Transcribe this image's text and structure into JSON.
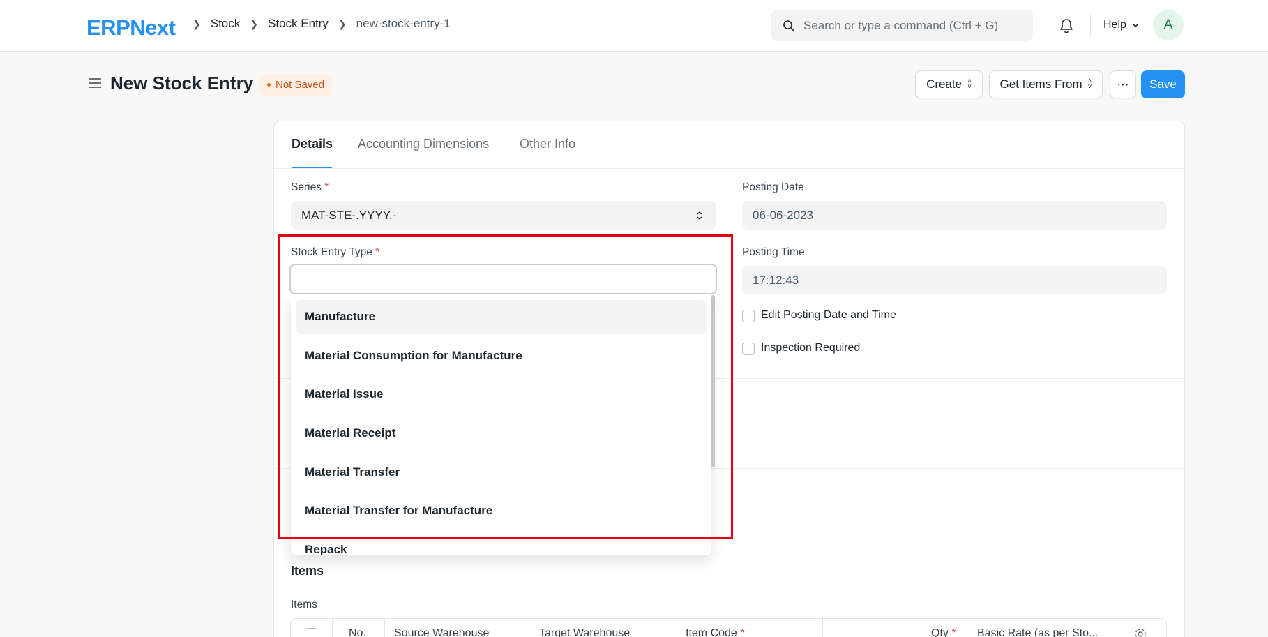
{
  "app": {
    "logo_text": "ERPNext",
    "brand_color": "#2490ef"
  },
  "breadcrumbs": [
    "Stock",
    "Stock Entry",
    "new-stock-entry-1"
  ],
  "search": {
    "placeholder": "Search or type a command (Ctrl + G)"
  },
  "nav": {
    "help_label": "Help",
    "avatar_letter": "A"
  },
  "page": {
    "title": "New Stock Entry",
    "status": "Not Saved"
  },
  "actions": {
    "create": "Create",
    "get_items_from": "Get Items From",
    "more": "···",
    "save": "Save"
  },
  "tabs": [
    "Details",
    "Accounting Dimensions",
    "Other Info"
  ],
  "form": {
    "series_label": "Series",
    "series_value": "MAT-STE-.YYYY.-",
    "stock_entry_type_label": "Stock Entry Type",
    "stock_entry_type_value": "",
    "posting_date_label": "Posting Date",
    "posting_date_value": "06-06-2023",
    "posting_time_label": "Posting Time",
    "posting_time_value": "17:12:43",
    "edit_posting_label": "Edit Posting Date and Time",
    "inspection_label": "Inspection Required"
  },
  "dropdown_options": [
    "Manufacture",
    "Material Consumption for Manufacture",
    "Material Issue",
    "Material Receipt",
    "Material Transfer",
    "Material Transfer for Manufacture",
    "Repack"
  ],
  "items": {
    "section_title": "Items",
    "table_label": "Items",
    "columns": [
      "No.",
      "Source Warehouse",
      "Target Warehouse",
      "Item Code",
      "Qty",
      "Basic Rate (as per Sto..."
    ]
  }
}
